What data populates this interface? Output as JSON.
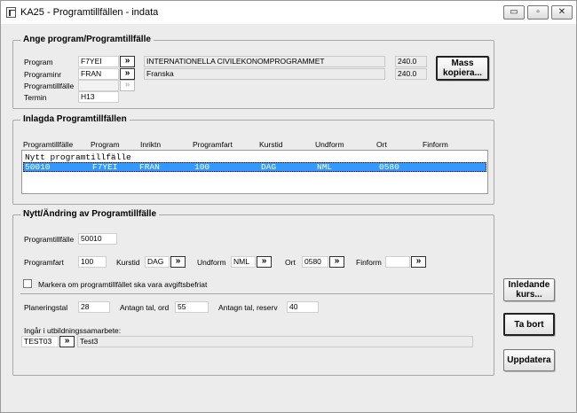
{
  "window": {
    "title": "KA25 - Programtillfällen - indata",
    "min": "▭",
    "restore": "▫",
    "close": "✕"
  },
  "ange": {
    "legend": "Ange program/Programtillfälle",
    "program_label": "Program",
    "program_value": "F7YEI",
    "program_name": "INTERNATIONELLA CIVILEKONOMPROGRAMMET",
    "program_points": "240.0",
    "programinr_label": "Programinr",
    "programinr_value": "FRAN",
    "programinr_name": "Franska",
    "programinr_points": "240.0",
    "programtillfalle_label": "Programtillfälle",
    "programtillfalle_value": "",
    "termin_label": "Termin",
    "termin_value": "H13",
    "mass_line1": "Mass",
    "mass_line2": "kopiera..."
  },
  "arrow": "»",
  "inlagda": {
    "legend": "Inlagda Programtillfällen",
    "headers": [
      "Programtillfälle",
      "Program",
      "Inriktn",
      "Programfart",
      "Kurstid",
      "Undform",
      "Ort",
      "Finform"
    ],
    "rows": [
      {
        "text": "Nytt programtillfälle"
      },
      {
        "cells": [
          "50010",
          "F7YEI",
          "FRAN",
          "100",
          "DAG",
          "NML",
          "0580",
          ""
        ]
      }
    ]
  },
  "nytt": {
    "legend": "Nytt/Ändring av Programtillfälle",
    "pt_label": "Programtillfälle",
    "pt_value": "50010",
    "programfart_label": "Programfart",
    "programfart_value": "100",
    "kurstid_label": "Kurstid",
    "kurstid_value": "DAG",
    "undform_label": "Undform",
    "undform_value": "NML",
    "ort_label": "Ort",
    "ort_value": "0580",
    "finform_label": "Finform",
    "finform_value": "",
    "checkbox_label": "Markera om programtillfället ska vara avgiftsbefriat",
    "plan_label": "Planeringstal",
    "plan_value": "28",
    "antag_ord_label": "Antagn tal, ord",
    "antag_ord_value": "55",
    "antag_res_label": "Antagn tal, reserv",
    "antag_res_value": "40",
    "ingar_label": "Ingår i utbildningssamarbete:",
    "ingar_code": "TEST03",
    "ingar_name": "Test3"
  },
  "buttons": {
    "inledande_1": "Inledande",
    "inledande_2": "kurs...",
    "ta_bort": "Ta bort",
    "uppdatera": "Uppdatera"
  }
}
